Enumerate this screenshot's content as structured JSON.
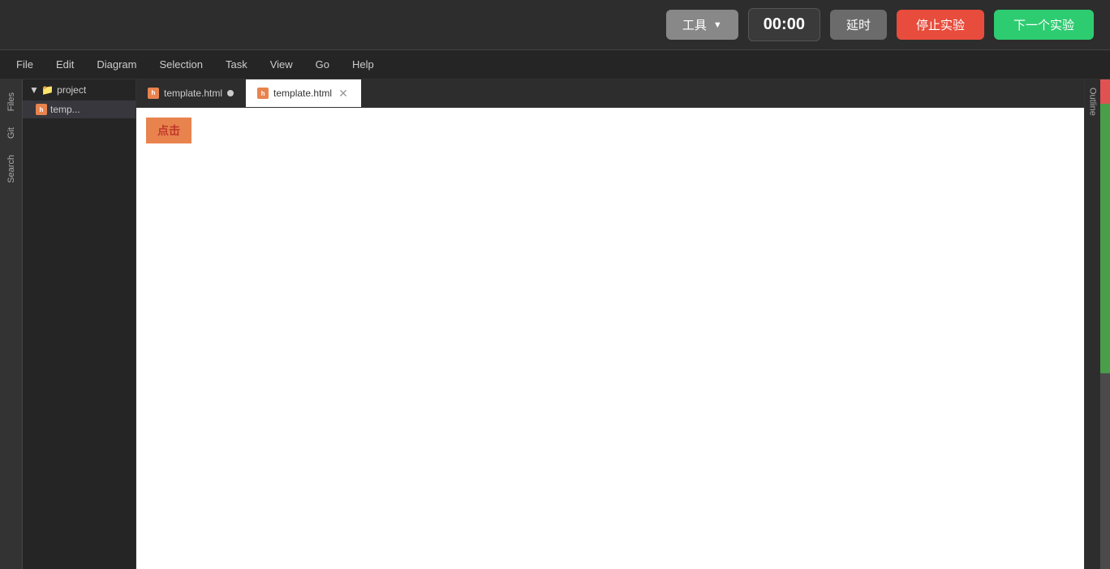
{
  "toolbar": {
    "tool_label": "工具",
    "timer": "00:00",
    "delay_label": "延时",
    "stop_label": "停止实验",
    "next_label": "下一个实验",
    "dropdown_arrow": "▼"
  },
  "menubar": {
    "items": [
      {
        "id": "file",
        "label": "File"
      },
      {
        "id": "edit",
        "label": "Edit"
      },
      {
        "id": "diagram",
        "label": "Diagram"
      },
      {
        "id": "selection",
        "label": "Selection"
      },
      {
        "id": "task",
        "label": "Task"
      },
      {
        "id": "view",
        "label": "View"
      },
      {
        "id": "go",
        "label": "Go"
      },
      {
        "id": "help",
        "label": "Help"
      }
    ]
  },
  "sidebar": {
    "icons": [
      {
        "id": "files",
        "label": "Files"
      },
      {
        "id": "git",
        "label": "Git"
      },
      {
        "id": "search",
        "label": "Search"
      }
    ]
  },
  "filetree": {
    "project_label": "project",
    "file_label": "temp..."
  },
  "tabs": [
    {
      "id": "tab1",
      "label": "template.html",
      "unsaved": true,
      "active": false
    },
    {
      "id": "tab2",
      "label": "template.html",
      "unsaved": false,
      "active": true,
      "closable": true
    }
  ],
  "editor": {
    "click_button_text": "点击"
  },
  "outline": {
    "label": "Outline"
  }
}
